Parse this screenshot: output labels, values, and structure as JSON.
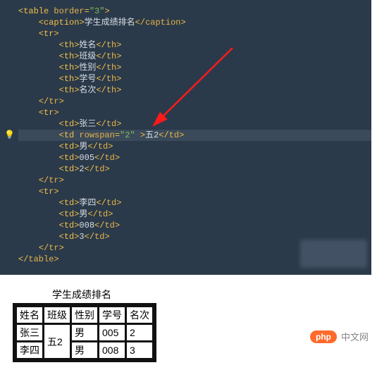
{
  "code": {
    "lines": [
      {
        "indent": 0,
        "type": "open",
        "tag": "table",
        "attrs": [
          {
            "name": "border",
            "value": "3"
          }
        ]
      },
      {
        "indent": 1,
        "type": "pair",
        "tag": "caption",
        "text": "学生成绩排名"
      },
      {
        "indent": 1,
        "type": "open",
        "tag": "tr"
      },
      {
        "indent": 2,
        "type": "pair",
        "tag": "th",
        "text": "姓名"
      },
      {
        "indent": 2,
        "type": "pair",
        "tag": "th",
        "text": "班级"
      },
      {
        "indent": 2,
        "type": "pair",
        "tag": "th",
        "text": "性别"
      },
      {
        "indent": 2,
        "type": "pair",
        "tag": "th",
        "text": "学号"
      },
      {
        "indent": 2,
        "type": "pair",
        "tag": "th",
        "text": "名次"
      },
      {
        "indent": 1,
        "type": "close",
        "tag": "tr"
      },
      {
        "indent": 1,
        "type": "open",
        "tag": "tr"
      },
      {
        "indent": 2,
        "type": "pair",
        "tag": "td",
        "text": "张三"
      },
      {
        "indent": 2,
        "type": "pair",
        "tag": "td",
        "text": "五2",
        "attrs": [
          {
            "name": "rowspan",
            "value": "2"
          }
        ],
        "hl": true,
        "trailspace": true,
        "bulb": true
      },
      {
        "indent": 2,
        "type": "pair",
        "tag": "td",
        "text": "男"
      },
      {
        "indent": 2,
        "type": "pair",
        "tag": "td",
        "text": "005"
      },
      {
        "indent": 2,
        "type": "pair",
        "tag": "td",
        "text": "2"
      },
      {
        "indent": 1,
        "type": "close",
        "tag": "tr"
      },
      {
        "indent": 1,
        "type": "open",
        "tag": "tr"
      },
      {
        "indent": 2,
        "type": "pair",
        "tag": "td",
        "text": "李四"
      },
      {
        "indent": 2,
        "type": "pair",
        "tag": "td",
        "text": "男"
      },
      {
        "indent": 2,
        "type": "pair",
        "tag": "td",
        "text": "008"
      },
      {
        "indent": 2,
        "type": "pair",
        "tag": "td",
        "text": "3"
      },
      {
        "indent": 1,
        "type": "close",
        "tag": "tr"
      },
      {
        "indent": 0,
        "type": "close",
        "tag": "table"
      }
    ]
  },
  "arrow": {
    "color": "#ff1a1a"
  },
  "rendered_table": {
    "caption": "学生成绩排名",
    "headers": [
      "姓名",
      "班级",
      "性别",
      "学号",
      "名次"
    ],
    "rows": [
      {
        "cells": [
          "张三",
          {
            "text": "五2",
            "rowspan": 2
          },
          "男",
          "005",
          "2"
        ]
      },
      {
        "cells": [
          "李四",
          "男",
          "008",
          "3"
        ]
      }
    ]
  },
  "watermark": {
    "badge": "php",
    "text": "中文网"
  }
}
